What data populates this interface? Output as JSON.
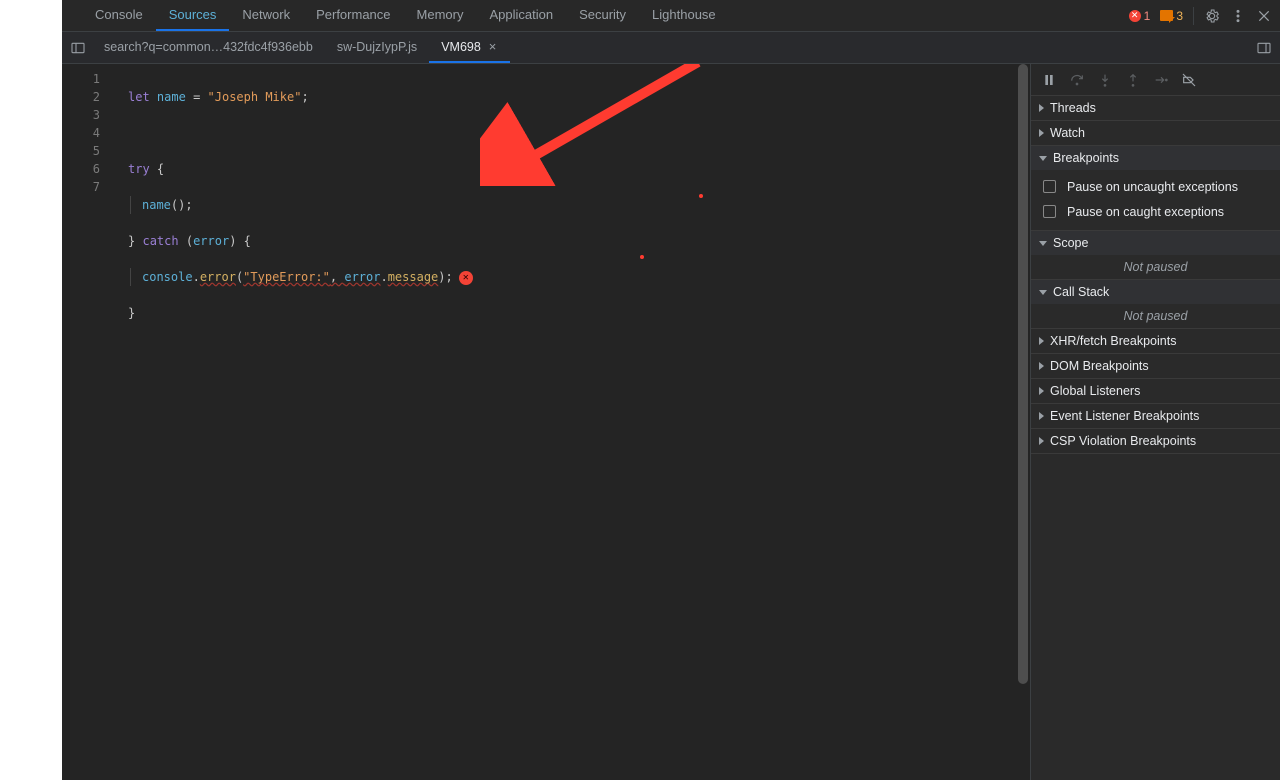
{
  "colors": {
    "error": "#f44336",
    "warn": "#e37400",
    "accent": "#1a73e8"
  },
  "toolbar": {
    "tabs": [
      "Console",
      "Sources",
      "Network",
      "Performance",
      "Memory",
      "Application",
      "Security",
      "Lighthouse"
    ],
    "active": "Sources",
    "error_count": "1",
    "warn_count": "3"
  },
  "file_tabs": {
    "items": [
      {
        "label": "search?q=common…432fdc4f936ebb"
      },
      {
        "label": "sw-DujzIypP.js"
      },
      {
        "label": "VM698"
      }
    ],
    "active": 2
  },
  "code": {
    "line_count": 7,
    "tokens": {
      "let": "let",
      "name": "name",
      "eq": "=",
      "str1": "\"Joseph Mike\"",
      "semi": ";",
      "try": "try",
      "lb": "{",
      "call": "name",
      "paren": "();",
      "rb": "}",
      "catch": "catch",
      "lp": "(",
      "err": "error",
      "rp": ")",
      "lb2": "{",
      "console": "console",
      "dot": ".",
      "errorfn": "error",
      "open": "(",
      "str2": "\"TypeError:\"",
      "comma": ",",
      "sp": " ",
      "err2": "error",
      "dot2": ".",
      "msg": "message",
      "close": ");",
      "rb2": "}"
    }
  },
  "debugger": {
    "sections": {
      "threads": "Threads",
      "watch": "Watch",
      "breakpoints": "Breakpoints",
      "bp_uncaught": "Pause on uncaught exceptions",
      "bp_caught": "Pause on caught exceptions",
      "scope": "Scope",
      "not_paused": "Not paused",
      "callstack": "Call Stack",
      "xhr": "XHR/fetch Breakpoints",
      "dom": "DOM Breakpoints",
      "global": "Global Listeners",
      "event": "Event Listener Breakpoints",
      "csp": "CSP Violation Breakpoints"
    }
  }
}
